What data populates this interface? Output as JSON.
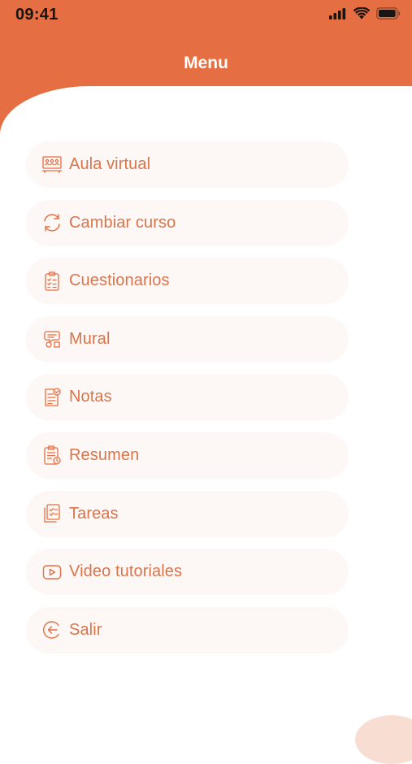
{
  "theme": {
    "accent": "#e56f42",
    "label_color": "#d9754b",
    "item_bg": "#fdf7f5"
  },
  "status_bar": {
    "time": "09:41",
    "icons": [
      "cellular-signal-icon",
      "wifi-icon",
      "battery-icon"
    ]
  },
  "header": {
    "title": "Menu"
  },
  "menu": {
    "items": [
      {
        "label": "Aula virtual",
        "icon": "virtual-classroom-icon"
      },
      {
        "label": "Cambiar curso",
        "icon": "refresh-icon"
      },
      {
        "label": "Cuestionarios",
        "icon": "clipboard-checklist-icon"
      },
      {
        "label": "Mural",
        "icon": "mural-icon"
      },
      {
        "label": "Notas",
        "icon": "grades-document-icon"
      },
      {
        "label": "Resumen",
        "icon": "summary-clipboard-icon"
      },
      {
        "label": "Tareas",
        "icon": "tasks-icon"
      },
      {
        "label": "Video tutoriales",
        "icon": "video-play-icon"
      },
      {
        "label": "Salir",
        "icon": "logout-icon"
      }
    ]
  }
}
